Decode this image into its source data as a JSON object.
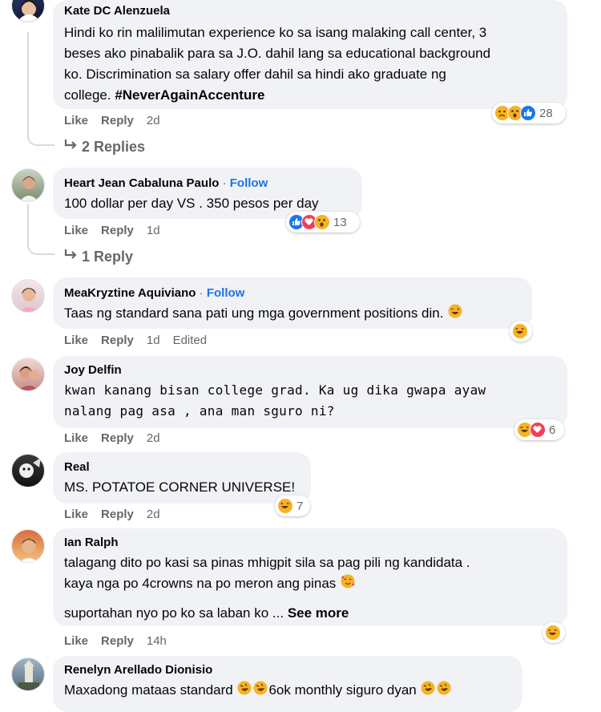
{
  "comments": [
    {
      "author": "Kate DC Alenzuela",
      "follow": "",
      "lines": [
        "Hindi ko rin malilimutan experience ko sa isang malaking call center, 3",
        "beses ako pinabalik para sa J.O. dahil lang sa educational background",
        "ko. Discrimination sa salary offer dahil sa hindi ako graduate ng",
        "college. "
      ],
      "hashtag": "#NeverAgainAccenture",
      "like": "Like",
      "reply": "Reply",
      "time": "2d",
      "edited": "",
      "reactions": [
        "sad",
        "wow",
        "like"
      ],
      "reaction_count": "28",
      "replies": "2 Replies"
    },
    {
      "author": "Heart Jean Cabaluna Paulo",
      "follow": "Follow",
      "lines": [
        "100 dollar per day VS . 350 pesos per day"
      ],
      "like": "Like",
      "reply": "Reply",
      "time": "1d",
      "edited": "",
      "reactions": [
        "like",
        "love",
        "wow"
      ],
      "reaction_count": "13",
      "replies": "1 Reply"
    },
    {
      "author": "MeaKryztine Aquiviano",
      "follow": "Follow",
      "lines": [
        "Taas ng standard sana pati ung mga government positions din."
      ],
      "like": "Like",
      "reply": "Reply",
      "time": "1d",
      "edited": "Edited",
      "reactions": [
        "haha"
      ],
      "reaction_count": ""
    },
    {
      "author": "Joy Delfin",
      "follow": "",
      "lines": [
        "kwan kanang bisan college grad. Ka ug dika gwapa ayaw",
        "nalang pag asa , ana man sguro ni?"
      ],
      "like": "Like",
      "reply": "Reply",
      "time": "2d",
      "edited": "",
      "reactions": [
        "haha",
        "love"
      ],
      "reaction_count": "6"
    },
    {
      "author": "Real",
      "follow": "",
      "lines": [
        "MS. POTATOE CORNER UNIVERSE!"
      ],
      "like": "Like",
      "reply": "Reply",
      "time": "2d",
      "edited": "",
      "reactions": [
        "haha"
      ],
      "reaction_count": "7"
    },
    {
      "author": "Ian Ralph",
      "follow": "",
      "lines": [
        "talagang dito po kasi sa pinas mhigpit sila sa pag pili ng kandidata .",
        "kaya nga po 4crowns na po meron ang pinas "
      ],
      "extra_line": "suportahan nyo po ko sa laban ko ... ",
      "see_more": "See more",
      "like": "Like",
      "reply": "Reply",
      "time": "14h",
      "edited": "",
      "reactions": [
        "haha"
      ],
      "reaction_count": ""
    },
    {
      "author": "Renelyn Arellado Dionisio",
      "follow": "",
      "lines": [
        "Maxadong mataas standard ",
        "6ok monthly siguro dyan "
      ],
      "like": "",
      "reply": "",
      "time": "",
      "edited": "",
      "reactions": [],
      "reaction_count": ""
    }
  ],
  "separator": " · "
}
